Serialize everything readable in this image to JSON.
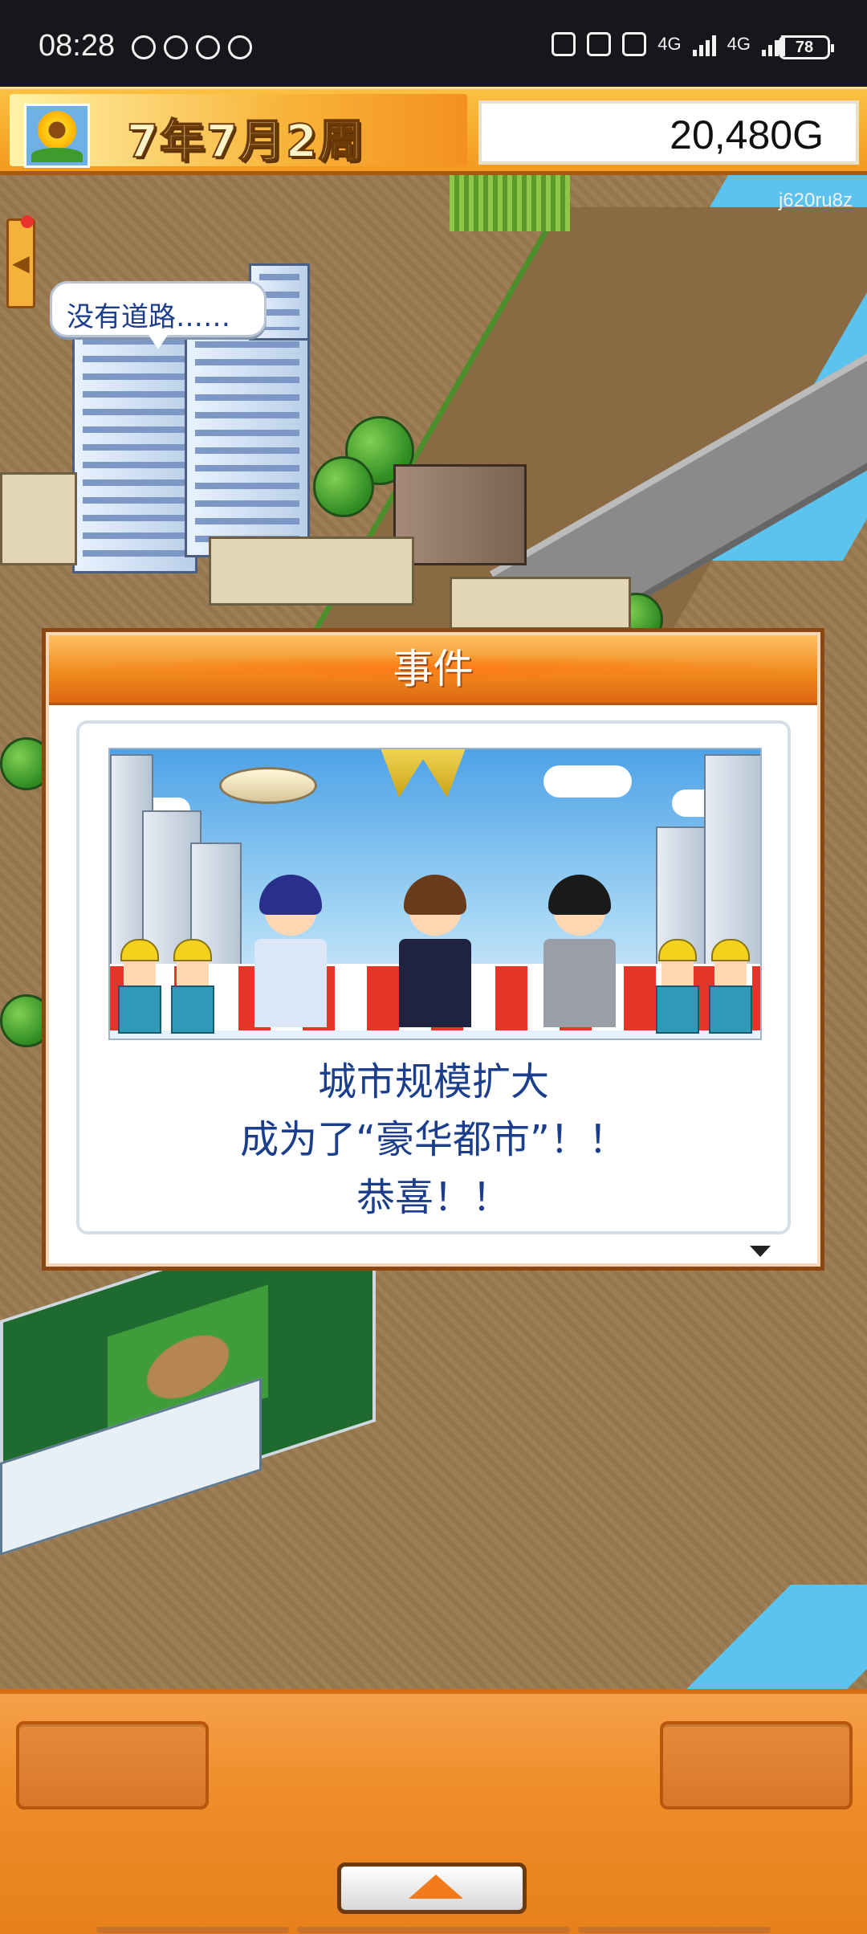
{
  "status_bar": {
    "time": "08:28",
    "network_1": "4G",
    "network_2": "4G",
    "battery": "78"
  },
  "top_bar": {
    "date": "7年7月2周",
    "money": "20,480G",
    "date_icon": "sunflower-icon"
  },
  "map": {
    "watermark": "j620ru8z",
    "speech_bubble": "没有道路……"
  },
  "event": {
    "title": "事件",
    "message_lines": [
      "城市规模扩大",
      "成为了“豪华都市”！！",
      "恭喜！！"
    ]
  },
  "bottom_panel": {
    "expand_icon": "triangle-up-icon"
  }
}
